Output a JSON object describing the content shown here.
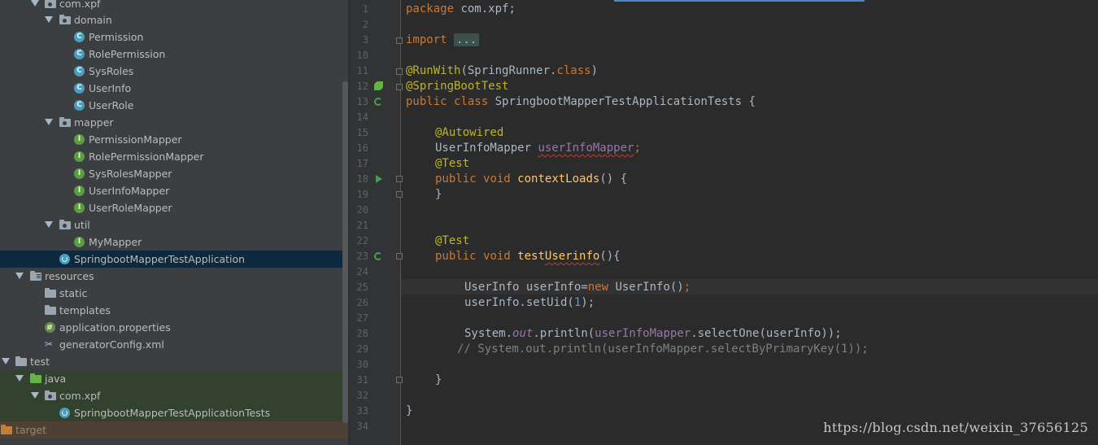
{
  "tree": {
    "rows": [
      {
        "label": "com.xpf",
        "type": "package",
        "arrow": true
      },
      {
        "label": "domain",
        "type": "package",
        "arrow": true
      },
      {
        "label": "Permission",
        "type": "class"
      },
      {
        "label": "RolePermission",
        "type": "class"
      },
      {
        "label": "SysRoles",
        "type": "class"
      },
      {
        "label": "UserInfo",
        "type": "class"
      },
      {
        "label": "UserRole",
        "type": "class"
      },
      {
        "label": "mapper",
        "type": "package",
        "arrow": true
      },
      {
        "label": "PermissionMapper",
        "type": "interface"
      },
      {
        "label": "RolePermissionMapper",
        "type": "interface"
      },
      {
        "label": "SysRolesMapper",
        "type": "interface"
      },
      {
        "label": "UserInfoMapper",
        "type": "interface"
      },
      {
        "label": "UserRoleMapper",
        "type": "interface"
      },
      {
        "label": "util",
        "type": "package",
        "arrow": true
      },
      {
        "label": "MyMapper",
        "type": "interface"
      },
      {
        "label": "SpringbootMapperTestApplication",
        "type": "boot",
        "selected": true
      },
      {
        "label": "resources",
        "type": "resources",
        "arrow": true
      },
      {
        "label": "static",
        "type": "folder"
      },
      {
        "label": "templates",
        "type": "folder"
      },
      {
        "label": "application.properties",
        "type": "spring"
      },
      {
        "label": "generatorConfig.xml",
        "type": "xml"
      },
      {
        "label": "test",
        "type": "folder",
        "arrow": true
      },
      {
        "label": "java",
        "type": "green-folder",
        "arrow": true
      },
      {
        "label": "com.xpf",
        "type": "package",
        "arrow": true
      },
      {
        "label": "SpringbootMapperTestApplicationTests",
        "type": "boot"
      },
      {
        "label": "target",
        "type": "orange-folder"
      }
    ]
  },
  "gutter": {
    "line_numbers": [
      "1",
      "2",
      "3",
      "10",
      "11",
      "12",
      "13",
      "14",
      "15",
      "16",
      "17",
      "18",
      "19",
      "20",
      "21",
      "22",
      "23",
      "24",
      "25",
      "26",
      "27",
      "28",
      "29",
      "30",
      "31",
      "32",
      "33",
      "34"
    ]
  },
  "code": {
    "l1": {
      "kw": "package",
      "rest": " com.xpf;"
    },
    "l3": {
      "kw": "import",
      "folded": "..."
    },
    "l11": {
      "ann": "@RunWith",
      "open": "(SpringRunner.",
      "kw": "class",
      "close": ")"
    },
    "l12": {
      "ann": "@SpringBootTest"
    },
    "l13": {
      "kw1": "public",
      "kw2": "class",
      "rest": " SpringbootMapperTestApplicationTests {"
    },
    "l15": {
      "ann": "@Autowired"
    },
    "l16": {
      "type": "UserInfoMapper ",
      "field": "userInfoMapper",
      "semi": ";"
    },
    "l17": {
      "ann": "@Test"
    },
    "l18": {
      "kw1": "public",
      "kw2": "void",
      "fn": "contextLoads",
      "rest": "() {"
    },
    "l19": {
      "text": "}"
    },
    "l22": {
      "ann": "@Test"
    },
    "l23": {
      "kw1": "public",
      "kw2": "void",
      "fn_a": "test",
      "fn_b": "Userinfo",
      "rest": "(){"
    },
    "l25": {
      "a": "UserInfo userInfo=",
      "kw": "new",
      "b": " UserInfo()",
      "semi": ";"
    },
    "l26": {
      "a": "userInfo.setUid(",
      "num": "1",
      "b": ");"
    },
    "l28": {
      "a": "System.",
      "out": "out",
      "b": ".println(",
      "field": "userInfoMapper",
      "c": ".selectOne(userInfo));"
    },
    "l29": {
      "comment": "// System.out.println(userInfoMapper.selectByPrimaryKey(1));"
    },
    "l31": {
      "text": "}"
    },
    "l33": {
      "text": "}"
    }
  },
  "watermark": "https://blog.csdn.net/weixin_37656125",
  "colors": {
    "keyword": "#cc7832",
    "annotation": "#bbb529",
    "field": "#9876aa",
    "number": "#6897bb",
    "method": "#ffc66d",
    "comment": "#808080"
  }
}
